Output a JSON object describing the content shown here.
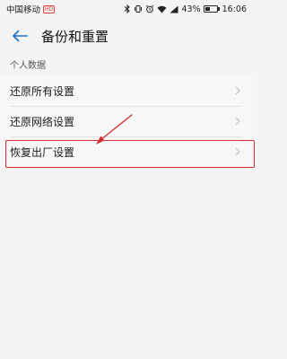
{
  "status_bar": {
    "carrier": "中国移动",
    "network_badge": "HD",
    "battery_percent": "43%",
    "battery_level": 0.43,
    "time": "16:06",
    "icons": [
      "bluetooth-icon",
      "vibrate-icon",
      "alarm-icon",
      "wifi-icon",
      "signal-icon",
      "battery-icon"
    ]
  },
  "header": {
    "title": "备份和重置",
    "back_icon": "back-arrow-icon"
  },
  "section": {
    "title": "个人数据",
    "items": [
      {
        "label": "还原所有设置"
      },
      {
        "label": "还原网络设置"
      },
      {
        "label": "恢复出厂设置"
      }
    ]
  },
  "colors": {
    "accent": "#1a73c8",
    "annotation": "#d32f2f",
    "background": "#f4f4f4"
  }
}
